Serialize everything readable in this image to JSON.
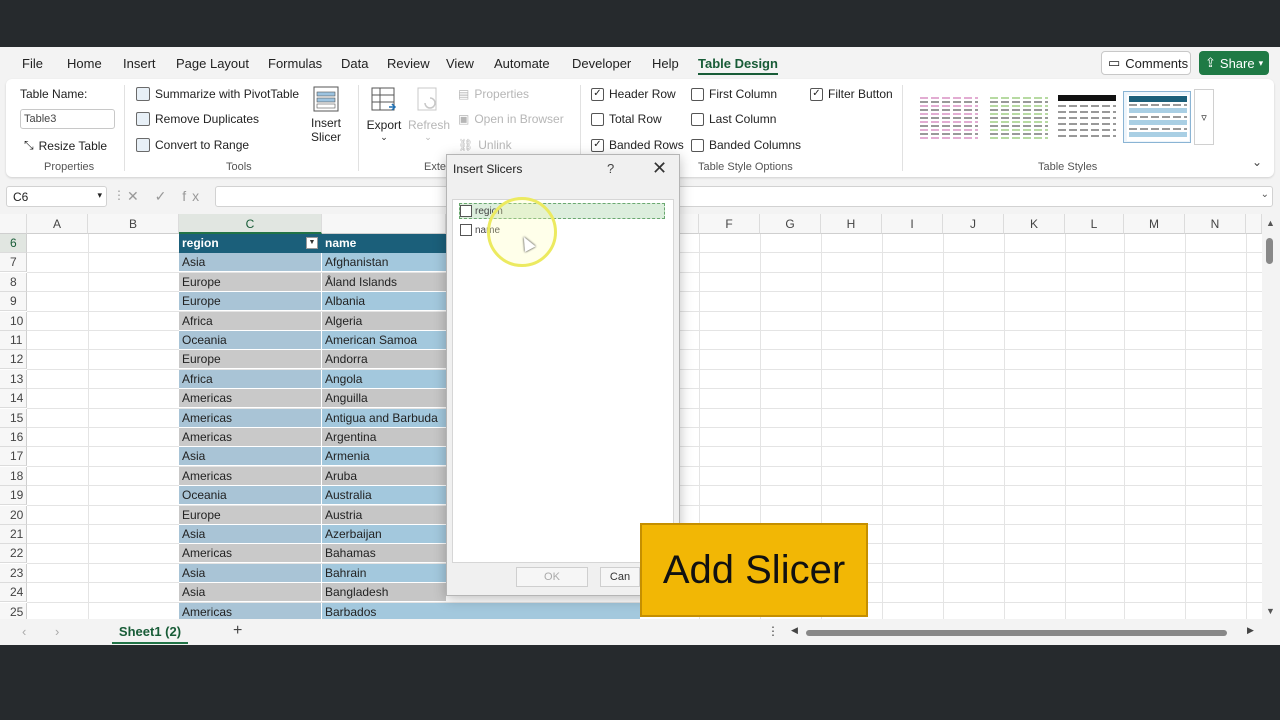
{
  "ribbon_tabs": [
    "File",
    "Home",
    "Insert",
    "Page Layout",
    "Formulas",
    "Data",
    "Review",
    "View",
    "Automate",
    "Developer",
    "Help",
    "Table Design"
  ],
  "active_tab": "Table Design",
  "comments_label": "Comments",
  "share_label": "Share",
  "properties": {
    "table_name_label": "Table Name:",
    "table_name_value": "Table3",
    "resize_label": "Resize Table",
    "group_label": "Properties"
  },
  "tools": {
    "summarize": "Summarize with PivotTable",
    "remove_dup": "Remove Duplicates",
    "convert": "Convert to Range",
    "insert_slicer_line1": "Insert",
    "insert_slicer_line2": "Slicer",
    "group_label": "Tools"
  },
  "external": {
    "export": "Export",
    "refresh": "Refresh",
    "properties": "Properties",
    "open_browser": "Open in Browser",
    "unlink": "Unlink",
    "group_label": "Exter"
  },
  "style_options": {
    "header_row": "Header Row",
    "total_row": "Total Row",
    "banded_rows": "Banded Rows",
    "first_column": "First Column",
    "last_column": "Last Column",
    "banded_columns": "Banded Columns",
    "filter_button": "Filter Button",
    "group_label": "Table Style Options"
  },
  "table_styles_label": "Table Styles",
  "name_box": "C6",
  "fx_symbols": "✕ ✓ fx",
  "columns": [
    "A",
    "B",
    "C",
    "",
    "",
    "F",
    "G",
    "H",
    "I",
    "J",
    "K",
    "L",
    "M",
    "N"
  ],
  "row_numbers": [
    "6",
    "7",
    "8",
    "9",
    "10",
    "11",
    "12",
    "13",
    "14",
    "15",
    "16",
    "17",
    "18",
    "19",
    "20",
    "21",
    "22",
    "23",
    "24",
    "25"
  ],
  "table_headers": [
    "region",
    "name"
  ],
  "table_rows": [
    [
      "Asia",
      "Afghanistan"
    ],
    [
      "Europe",
      "Åland Islands"
    ],
    [
      "Europe",
      "Albania"
    ],
    [
      "Africa",
      "Algeria"
    ],
    [
      "Oceania",
      "American Samoa"
    ],
    [
      "Europe",
      "Andorra"
    ],
    [
      "Africa",
      "Angola"
    ],
    [
      "Americas",
      "Anguilla"
    ],
    [
      "Americas",
      "Antigua and Barbuda"
    ],
    [
      "Americas",
      "Argentina"
    ],
    [
      "Asia",
      "Armenia"
    ],
    [
      "Americas",
      "Aruba"
    ],
    [
      "Oceania",
      "Australia"
    ],
    [
      "Europe",
      "Austria"
    ],
    [
      "Asia",
      "Azerbaijan"
    ],
    [
      "Americas",
      "Bahamas"
    ],
    [
      "Asia",
      "Bahrain"
    ],
    [
      "Asia",
      "Bangladesh"
    ],
    [
      "Americas",
      "Barbados"
    ]
  ],
  "sheet_tab": "Sheet1 (2)",
  "dialog": {
    "title": "Insert Slicers",
    "help": "?",
    "close": "✕",
    "items": [
      "region",
      "name"
    ],
    "ok": "OK",
    "cancel": "Can"
  },
  "banner": "Add Slicer",
  "colors": {
    "accent_green": "#185c37",
    "table_header": "#1b5f7a",
    "band_light": "#a9c4d6",
    "band_grey": "#c9c9c9",
    "banner_yellow": "#f2b705"
  }
}
